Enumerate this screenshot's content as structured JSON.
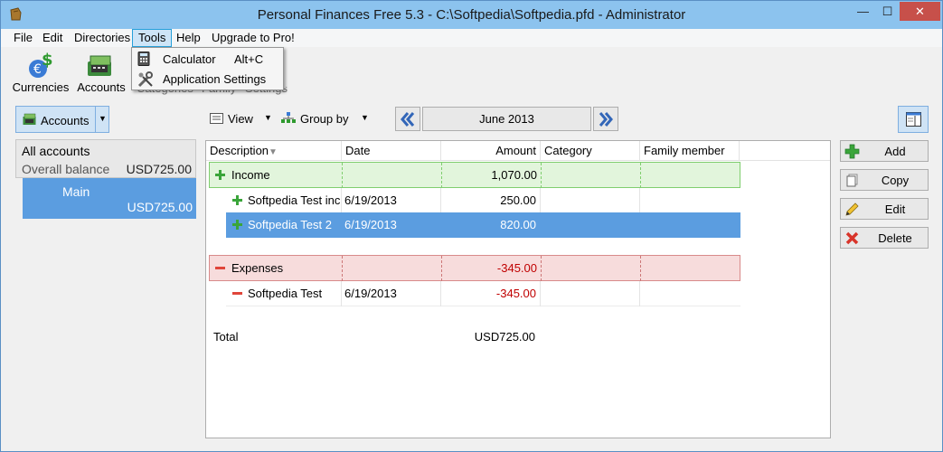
{
  "window": {
    "title": "Personal Finances Free 5.3 - C:\\Softpedia\\Softpedia.pfd - Administrator",
    "minimize": "—",
    "maximize": "☐",
    "close": "✕"
  },
  "menubar": {
    "items": [
      "File",
      "Edit",
      "Directories",
      "Tools",
      "Help",
      "Upgrade to Pro!"
    ],
    "active": "Tools"
  },
  "toolbar": {
    "currencies": "Currencies",
    "accounts": "Accounts",
    "categories_partial": "Categories",
    "family_partial": "Family",
    "settings_partial": "Settings"
  },
  "tools_menu": {
    "items": [
      {
        "label": "Calculator",
        "shortcut": "Alt+C",
        "icon": "calculator-icon"
      },
      {
        "label": "Application Settings",
        "shortcut": "",
        "icon": "tools-icon"
      }
    ]
  },
  "left_panel": {
    "selector_label": "Accounts",
    "all_accounts": "All accounts",
    "overall_balance_label": "Overall balance",
    "overall_balance_value": "USD725.00",
    "main_account_name": "Main",
    "main_account_balance": "USD725.00"
  },
  "viewbar": {
    "view_label": "View",
    "group_by_label": "Group by",
    "month": "June 2013"
  },
  "table": {
    "columns": [
      "Description",
      "Date",
      "Amount",
      "Category",
      "Family member"
    ],
    "income": {
      "label": "Income",
      "amount": "1,070.00",
      "rows": [
        {
          "description": "Softpedia Test inc",
          "date": "6/19/2013",
          "amount": "250.00",
          "selected": false
        },
        {
          "description": "Softpedia Test 2",
          "date": "6/19/2013",
          "amount": "820.00",
          "selected": true
        }
      ]
    },
    "expenses": {
      "label": "Expenses",
      "amount": "-345.00",
      "rows": [
        {
          "description": "Softpedia Test",
          "date": "6/19/2013",
          "amount": "-345.00"
        }
      ]
    },
    "total_label": "Total",
    "total_value": "USD725.00"
  },
  "actions": {
    "add": "Add",
    "copy": "Copy",
    "edit": "Edit",
    "delete": "Delete"
  },
  "colors": {
    "selection": "#5b9de0",
    "income_bg": "#e2f5dc",
    "expenses_bg": "#f7dcdc",
    "expense_text": "#c00000",
    "titlebar": "#8cc3ee"
  }
}
